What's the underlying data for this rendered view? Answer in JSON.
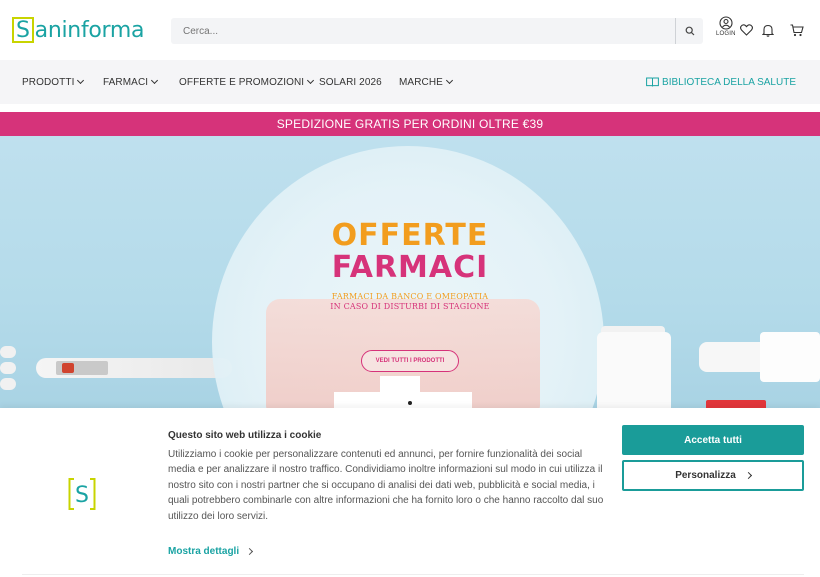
{
  "header": {
    "logo_bracket": "S",
    "logo_rest": "aninforma",
    "search_placeholder": "Cerca...",
    "login_label": "LOGIN",
    "icons": [
      "search-icon",
      "user-icon",
      "heart-icon",
      "bell-icon",
      "cart-icon"
    ]
  },
  "nav": {
    "items": [
      {
        "label": "PRODOTTI",
        "dropdown": true
      },
      {
        "label": "FARMACI",
        "dropdown": true
      },
      {
        "label": "OFFERTE E PROMOZIONI",
        "dropdown": true
      },
      {
        "label": "SOLARI 2026",
        "dropdown": false
      },
      {
        "label": "MARCHE",
        "dropdown": true
      }
    ],
    "library_label": "BIBLIOTECA DELLA SALUTE"
  },
  "promo": {
    "text": "SPEDIZIONE GRATIS PER ORDINI OLTRE €39"
  },
  "hero": {
    "title_1": "OFFERTE",
    "title_2": "FARMACI",
    "subtitle_1": "FARMACI DA BANCO E OMEOPATIA",
    "subtitle_2": "IN CASO DI DISTURBI DI STAGIONE",
    "cta": "VEDI TUTTI I PRODOTTI"
  },
  "cookie": {
    "title": "Questo sito web utilizza i cookie",
    "text": "Utilizziamo i cookie per personalizzare contenuti ed annunci, per fornire funzionalità dei social media e per analizzare il nostro traffico. Condividiamo inoltre informazioni sul modo in cui utilizza il nostro sito con i nostri partner che si occupano di analisi dei dati web, pubblicità e social media, i quali potrebbero combinarle con altre informazioni che ha fornito loro o che hanno raccolto dal suo utilizzo dei loro servizi.",
    "more_label": "Mostra dettagli",
    "accept_label": "Accetta tutti",
    "customize_label": "Personalizza",
    "logo_letter": "S"
  },
  "colors": {
    "brand_teal": "#1aa3a3",
    "brand_lime": "#c8d400",
    "promo_pink": "#d6337a",
    "hero_orange": "#f29d1e",
    "accept_teal": "#1a9c99"
  }
}
